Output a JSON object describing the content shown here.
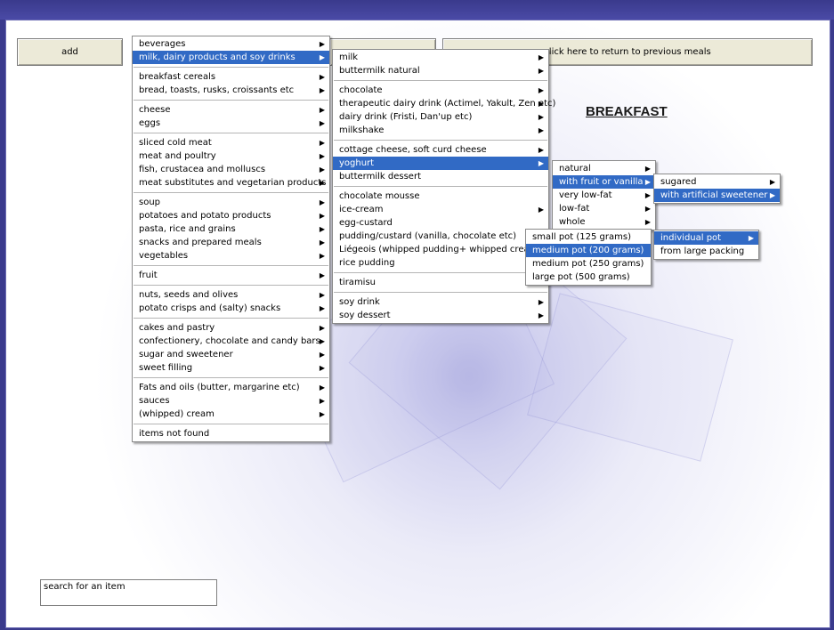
{
  "toolbar": {
    "add_label": "add",
    "return_label": "click here to return to previous meals"
  },
  "page_title": "BREAKFAST",
  "search": {
    "placeholder": "search for an item"
  },
  "menus": {
    "categories": [
      [
        {
          "label": "beverages",
          "sub": true
        },
        {
          "label": "milk, dairy products and soy drinks",
          "sub": true,
          "sel": true
        }
      ],
      [
        {
          "label": "breakfast cereals",
          "sub": true
        },
        {
          "label": "bread, toasts, rusks, croissants etc",
          "sub": true
        }
      ],
      [
        {
          "label": "cheese",
          "sub": true
        },
        {
          "label": "eggs",
          "sub": true
        }
      ],
      [
        {
          "label": "sliced cold meat",
          "sub": true
        },
        {
          "label": "meat and poultry",
          "sub": true
        },
        {
          "label": "fish, crustacea and molluscs",
          "sub": true
        },
        {
          "label": "meat substitutes and vegetarian products",
          "sub": true
        }
      ],
      [
        {
          "label": "soup",
          "sub": true
        },
        {
          "label": "potatoes and potato products",
          "sub": true
        },
        {
          "label": "pasta, rice and grains",
          "sub": true
        },
        {
          "label": "snacks and prepared meals",
          "sub": true
        },
        {
          "label": "vegetables",
          "sub": true
        }
      ],
      [
        {
          "label": "fruit",
          "sub": true
        }
      ],
      [
        {
          "label": "nuts, seeds and olives",
          "sub": true
        },
        {
          "label": "potato crisps and (salty) snacks",
          "sub": true
        }
      ],
      [
        {
          "label": "cakes and pastry",
          "sub": true
        },
        {
          "label": "confectionery, chocolate and candy bars",
          "sub": true
        },
        {
          "label": "sugar and sweetener",
          "sub": true
        },
        {
          "label": "sweet filling",
          "sub": true
        }
      ],
      [
        {
          "label": "Fats and oils (butter, margarine etc)",
          "sub": true
        },
        {
          "label": "sauces",
          "sub": true
        },
        {
          "label": "(whipped) cream",
          "sub": true
        }
      ],
      [
        {
          "label": "items not found",
          "sub": false
        }
      ]
    ],
    "dairy": [
      [
        {
          "label": "milk",
          "sub": true
        },
        {
          "label": "buttermilk natural",
          "sub": true
        }
      ],
      [
        {
          "label": "chocolate",
          "sub": true
        },
        {
          "label": "therapeutic dairy drink (Actimel, Yakult, Zen etc)",
          "sub": true
        },
        {
          "label": "dairy drink (Fristi, Dan'up etc)",
          "sub": true
        },
        {
          "label": "milkshake",
          "sub": true
        }
      ],
      [
        {
          "label": "cottage cheese, soft curd cheese",
          "sub": true
        },
        {
          "label": "yoghurt",
          "sub": true,
          "sel": true
        },
        {
          "label": "buttermilk dessert",
          "sub": false
        }
      ],
      [
        {
          "label": "chocolate mousse",
          "sub": false
        },
        {
          "label": "ice-cream",
          "sub": true
        },
        {
          "label": "egg-custard",
          "sub": false
        },
        {
          "label": "pudding/custard (vanilla, chocolate etc)",
          "sub": false
        },
        {
          "label": "Liégeois (whipped pudding+ whipped cream)",
          "sub": false
        },
        {
          "label": "rice pudding",
          "sub": false
        }
      ],
      [
        {
          "label": "tiramisu",
          "sub": false
        }
      ],
      [
        {
          "label": "soy drink",
          "sub": true
        },
        {
          "label": "soy dessert",
          "sub": true
        }
      ]
    ],
    "yoghurt": [
      [
        {
          "label": "natural",
          "sub": true
        },
        {
          "label": "with fruit or vanilla",
          "sub": true,
          "sel": true
        },
        {
          "label": "very low-fat",
          "sub": true
        },
        {
          "label": "low-fat",
          "sub": true
        },
        {
          "label": "whole",
          "sub": true
        }
      ]
    ],
    "sweetener": [
      [
        {
          "label": "sugared",
          "sub": true
        },
        {
          "label": "with artificial sweetener",
          "sub": true,
          "sel": true
        }
      ]
    ],
    "pots": [
      [
        {
          "label": "small pot (125 grams)",
          "sub": false
        },
        {
          "label": "medium pot (200 grams)",
          "sub": false,
          "sel": true
        },
        {
          "label": "medium pot (250 grams)",
          "sub": false
        },
        {
          "label": "large pot (500 grams)",
          "sub": false
        }
      ]
    ],
    "packing": [
      [
        {
          "label": "individual pot",
          "sub": true,
          "sel": true
        },
        {
          "label": "from large packing",
          "sub": false
        }
      ]
    ]
  },
  "icons": {
    "submenu_arrow": "arrow-right-icon",
    "arrow_glyph": "▶"
  }
}
